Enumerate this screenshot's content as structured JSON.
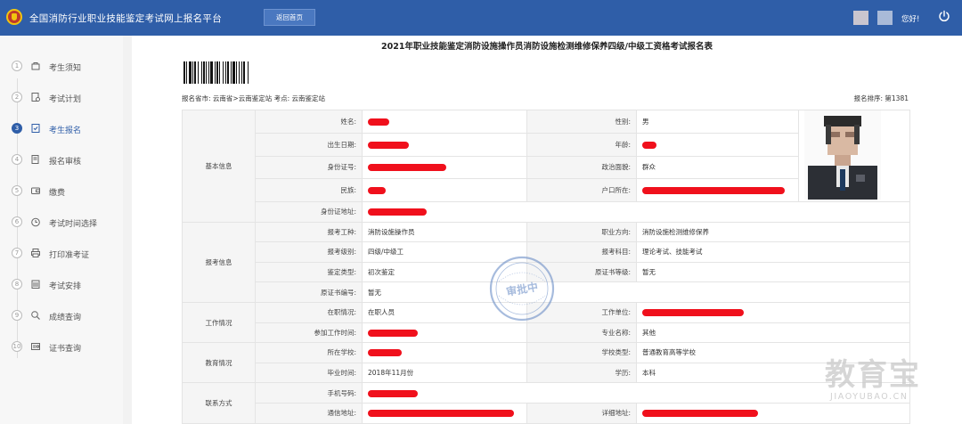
{
  "header": {
    "title": "全国消防行业职业技能鉴定考试网上报名平台",
    "back_label": "返回首页",
    "greeting": "您好!",
    "logo_icon": "fire-badge-icon",
    "power_icon": "power-icon"
  },
  "sidebar": {
    "active_index": 2,
    "steps": [
      {
        "num": "1",
        "label": "考生须知",
        "icon": "notice-icon"
      },
      {
        "num": "2",
        "label": "考试计划",
        "icon": "plan-icon"
      },
      {
        "num": "3",
        "label": "考生报名",
        "icon": "signup-icon"
      },
      {
        "num": "4",
        "label": "报名审核",
        "icon": "review-icon"
      },
      {
        "num": "5",
        "label": "缴费",
        "icon": "wallet-icon"
      },
      {
        "num": "6",
        "label": "考试时间选择",
        "icon": "clock-icon"
      },
      {
        "num": "7",
        "label": "打印准考证",
        "icon": "printer-icon"
      },
      {
        "num": "8",
        "label": "考试安排",
        "icon": "calendar-icon"
      },
      {
        "num": "9",
        "label": "成绩查询",
        "icon": "search-icon"
      },
      {
        "num": "10",
        "label": "证书查询",
        "icon": "certificate-icon"
      }
    ]
  },
  "doc": {
    "title": "2021年职业技能鉴定消防设施操作员消防设施检测维修保养四级/中级工资格考试报名表",
    "meta_left": "报名省市: 云南省>云南鉴定站  考点: 云南鉴定站",
    "meta_right": "报名排序: 第1381",
    "stamp_text": "审批中",
    "watermark_main": "教育宝",
    "watermark_sub": "JIAOYUBAO.CN"
  },
  "form": {
    "groups": {
      "basic": "基本信息",
      "exam": "报考信息",
      "work": "工作情况",
      "edu": "教育情况",
      "contact": "联系方式"
    },
    "labels": {
      "name": "姓名:",
      "gender": "性别:",
      "birth": "出生日期:",
      "age": "年龄:",
      "id_no": "身份证号:",
      "politics": "政治面貌:",
      "ethnic": "民族:",
      "hukou": "户口所在:",
      "id_addr": "身份证地址:",
      "job": "报考工种:",
      "direction": "职业方向:",
      "level": "报考级别:",
      "subjects": "报考科目:",
      "appraisal": "鉴定类型:",
      "orig_level": "原证书等级:",
      "orig_no": "原证书编号:",
      "status": "在职情况:",
      "employer": "工作单位:",
      "work_start": "参加工作时间:",
      "major": "专业名称:",
      "school": "所在学校:",
      "school_type": "学校类型:",
      "grad_time": "毕业时间:",
      "education": "学历:",
      "phone": "手机号码:",
      "mail_addr": "通信地址:",
      "post_addr": "详细地址:"
    },
    "values": {
      "gender": "男",
      "politics": "群众",
      "job": "消防设施操作员",
      "direction": "消防设施检测维修保养",
      "level": "四级/中级工",
      "subjects": "理论考试、技能考试",
      "appraisal": "初次鉴定",
      "orig_level": "暂无",
      "orig_no": "暂无",
      "status": "在职人员",
      "major": "其他",
      "school_type": "普通教育高等学校",
      "grad_time": "2018年11月份",
      "education": "本科"
    }
  },
  "colors": {
    "header_bg": "#2f5ea8",
    "redaction": "#f0101c",
    "active_step": "#2f5ea8"
  }
}
